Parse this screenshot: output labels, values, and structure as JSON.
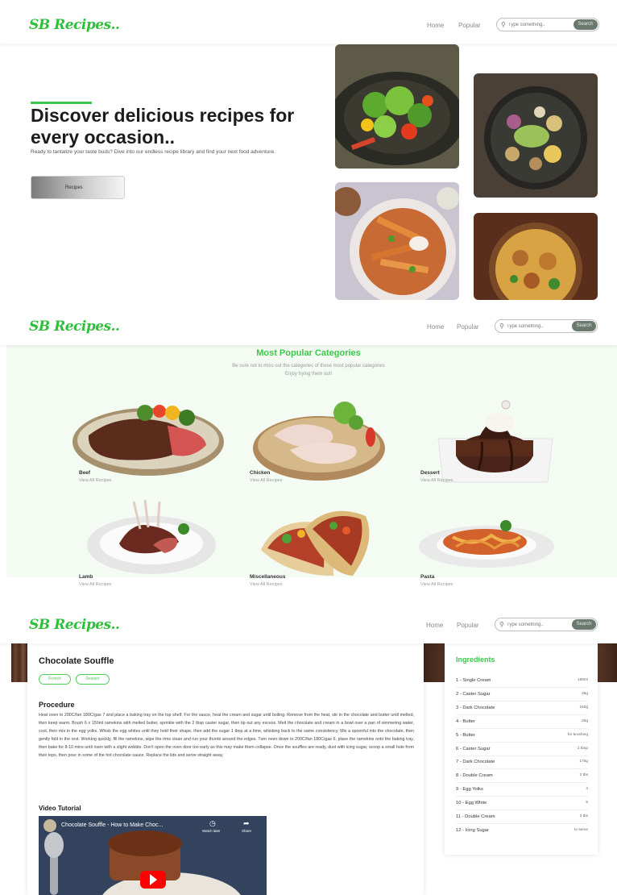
{
  "brand": {
    "logo": "SB Recipes..",
    "accent": "#3cc84a"
  },
  "nav": {
    "home": "Home",
    "popular": "Popular",
    "search_placeholder": "Type something..",
    "search_button": "Search"
  },
  "hero": {
    "title": "Discover delicious recipes for every occasion..",
    "subtitle": "Ready to tantalize your taste buds? Dive into our endless recipe library and find your next food adventure.",
    "button": "Recipes"
  },
  "categories": {
    "title": "Most Popular Categories",
    "subtitle_1": "Be sure not to miss out the categories of these most popular categories",
    "subtitle_2": "Enjoy trying them out!",
    "items": [
      {
        "name": "Beef",
        "count": "View All Recipes"
      },
      {
        "name": "Chicken",
        "count": "View All Recipes"
      },
      {
        "name": "Dessert",
        "count": "View All Recipes"
      },
      {
        "name": "Lamb",
        "count": "View All Recipes"
      },
      {
        "name": "Miscellaneous",
        "count": "View All Recipes"
      },
      {
        "name": "Pasta",
        "count": "View All Recipes"
      }
    ]
  },
  "recipe": {
    "title": "Chocolate Souffle",
    "tags": [
      "French",
      "Dessert"
    ],
    "procedure_heading": "Procedure",
    "procedure": "Heat oven to 200C/fan 180C/gas 7 and place a baking tray on the top shelf. For the sauce, heat the cream and sugar until boiling. Remove from the heat, stir in the chocolate and butter until melted, then keep warm. Brush 6 x 150ml ramekins with melted butter, sprinkle with the 2 tbsp caster sugar, then tip out any excess. Melt the chocolate and cream in a bowl over a pan of simmering water, cool, then mix in the egg yolks. Whisk the egg whites until they hold their shape, then add the sugar 1 tbsp at a time, whisking back to the same consistency. Mix a spoonful into the chocolate, then gently fold in the rest. Working quickly, fill the ramekins, wipe the rims clean and run your thumb around the edges. Turn oven down to 200C/fan 180C/gas 6, place the ramekins onto the baking tray, then bake for 8-10 mins until risen with a slight wobble. Don't open the oven door too early as this may make them collapse. Once the souffles are ready, dust with icing sugar, scoop a small hole from their tops, then pour in some of the hot chocolate sauce. Replace the lids and serve straight away.",
    "video_heading": "Video Tutorial",
    "video_title": "Chocolate Souffle - How to Make Choc...",
    "video_watch_later": "Watch later",
    "video_share": "Share"
  },
  "ingredients": {
    "heading": "Ingredients",
    "items": [
      {
        "label": "1 - Single Cream",
        "qty": "150ml"
      },
      {
        "label": "2 - Caster Sugar",
        "qty": "25g"
      },
      {
        "label": "3 - Dark Chocolate",
        "qty": "150g"
      },
      {
        "label": "4 - Butter",
        "qty": "25g"
      },
      {
        "label": "5 - Butter",
        "qty": "for brushing"
      },
      {
        "label": "6 - Caster Sugar",
        "qty": "2 tbsp"
      },
      {
        "label": "7 - Dark Chocolate",
        "qty": "175g"
      },
      {
        "label": "8 - Double Cream",
        "qty": "3 tbs"
      },
      {
        "label": "9 - Egg Yolks",
        "qty": "4"
      },
      {
        "label": "10 - Egg White",
        "qty": "5"
      },
      {
        "label": "11 - Double Cream",
        "qty": "3 tbs"
      },
      {
        "label": "12 - Icing Sugar",
        "qty": "to serve"
      }
    ]
  }
}
